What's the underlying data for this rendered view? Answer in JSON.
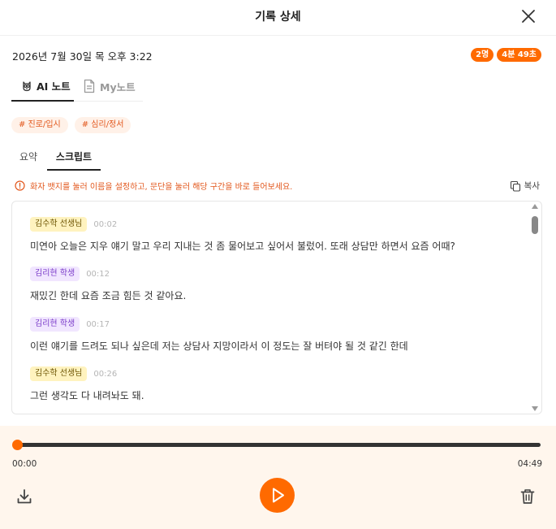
{
  "header": {
    "title": "기록 상세",
    "close_icon": "close-icon"
  },
  "record": {
    "date": "2026년 7월 30일 목 오후 3:22",
    "participants": "2명",
    "duration": "4분 49초"
  },
  "note_tabs": [
    {
      "label": "AI 노트",
      "icon": "owl-icon",
      "active": true
    },
    {
      "label": "My노트",
      "icon": "document-icon",
      "active": false
    }
  ],
  "tags": [
    "# 진로/입시",
    "# 심리/정서"
  ],
  "sub_tabs": [
    {
      "label": "요약",
      "active": false
    },
    {
      "label": "스크립트",
      "active": true
    }
  ],
  "notice": "화자 뱃지를 눌러 이름을 설정하고, 문단을 눌러 해당 구간을 바로 들어보세요.",
  "copy_label": "복사",
  "script": [
    {
      "speaker": "김수학 선생님",
      "role": "teacher",
      "time": "00:02",
      "text": "미연아 오늘은 지우 얘기 말고 우리 지내는 것 좀 물어보고 싶어서 불렀어. 또래 상담만 하면서 요즘 어때?"
    },
    {
      "speaker": "김리현 학생",
      "role": "student",
      "time": "00:12",
      "text": "재밌긴 한데 요즘 조금 힘든 것 같아요."
    },
    {
      "speaker": "김리현 학생",
      "role": "student",
      "time": "00:17",
      "text": "이런 얘기를 드려도 되나 싶은데 저는 상담사 지망이라서 이 정도는 잘 버텨야 될 것 같긴 한데"
    },
    {
      "speaker": "김수학 선생님",
      "role": "teacher",
      "time": "00:26",
      "text": "그런 생각도 다 내려놔도 돼."
    }
  ],
  "player": {
    "current_time": "00:00",
    "total_time": "04:49",
    "progress": 0.0
  },
  "colors": {
    "accent": "#ff6a00",
    "tag_bg": "#fff1e8",
    "player_bg": "#fff6ed"
  }
}
